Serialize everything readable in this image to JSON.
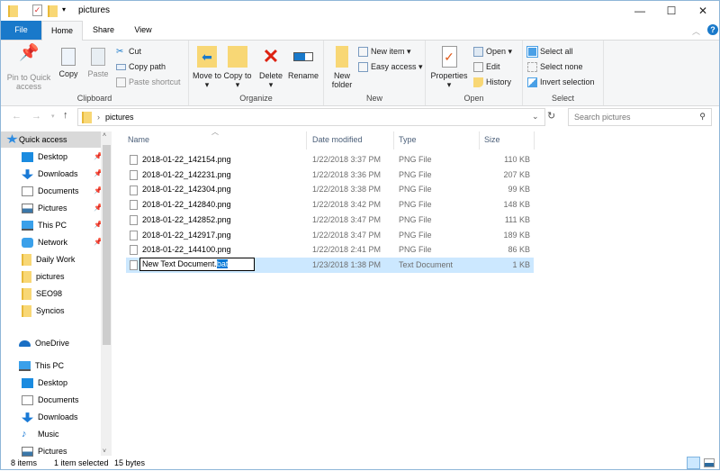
{
  "window": {
    "title": "pictures",
    "minimize": "—",
    "maximize": "☐",
    "close": "✕"
  },
  "tabs": [
    {
      "label": "File"
    },
    {
      "label": "Home"
    },
    {
      "label": "Share"
    },
    {
      "label": "View"
    }
  ],
  "ribbon": {
    "clipboard": {
      "label": "Clipboard",
      "pin": "Pin to Quick access",
      "copy": "Copy",
      "paste": "Paste",
      "cut": "Cut",
      "copy_path": "Copy path",
      "paste_shortcut": "Paste shortcut"
    },
    "organize": {
      "label": "Organize",
      "move_to": "Move to ▾",
      "copy_to": "Copy to ▾",
      "delete": "Delete",
      "rename": "Rename"
    },
    "new": {
      "label": "New",
      "new_folder": "New folder",
      "new_item": "New item ▾",
      "easy_access": "Easy access ▾"
    },
    "open": {
      "label": "Open",
      "properties": "Properties",
      "open": "Open ▾",
      "edit": "Edit",
      "history": "History"
    },
    "select": {
      "label": "Select",
      "select_all": "Select all",
      "select_none": "Select none",
      "invert": "Invert selection"
    }
  },
  "address": {
    "path": "pictures",
    "search_placeholder": "Search pictures"
  },
  "nav": [
    {
      "label": "Quick access",
      "icon": "star-icon",
      "level": 0,
      "selected": true
    },
    {
      "label": "Desktop",
      "icon": "desktop-icon",
      "level": 1,
      "pinned": true
    },
    {
      "label": "Downloads",
      "icon": "download-icon",
      "level": 1,
      "pinned": true
    },
    {
      "label": "Documents",
      "icon": "documents-icon",
      "level": 1,
      "pinned": true
    },
    {
      "label": "Pictures",
      "icon": "pictures-icon",
      "level": 1,
      "pinned": true
    },
    {
      "label": "This PC",
      "icon": "computer-icon",
      "level": 1,
      "pinned": true
    },
    {
      "label": "Network",
      "icon": "network-icon",
      "level": 1,
      "pinned": true
    },
    {
      "label": "Daily Work",
      "icon": "folder-icon",
      "level": 1
    },
    {
      "label": "pictures",
      "icon": "folder-icon",
      "level": 1
    },
    {
      "label": "SEO98",
      "icon": "folder-icon",
      "level": 1
    },
    {
      "label": "Syncios",
      "icon": "folder-icon",
      "level": 1
    },
    {
      "label": "OneDrive",
      "icon": "cloud-icon",
      "level": 0
    },
    {
      "label": "This PC",
      "icon": "computer-icon",
      "level": 0
    },
    {
      "label": "Desktop",
      "icon": "desktop-icon",
      "level": 1
    },
    {
      "label": "Documents",
      "icon": "documents-icon",
      "level": 1
    },
    {
      "label": "Downloads",
      "icon": "download-icon",
      "level": 1
    },
    {
      "label": "Music",
      "icon": "music-icon",
      "level": 1
    },
    {
      "label": "Pictures",
      "icon": "pictures-icon",
      "level": 1
    }
  ],
  "columns": {
    "name": "Name",
    "date": "Date modified",
    "type": "Type",
    "size": "Size"
  },
  "files": [
    {
      "name": "2018-01-22_142154.png",
      "date": "1/22/2018 3:37 PM",
      "type": "PNG File",
      "size": "110 KB"
    },
    {
      "name": "2018-01-22_142231.png",
      "date": "1/22/2018 3:36 PM",
      "type": "PNG File",
      "size": "207 KB"
    },
    {
      "name": "2018-01-22_142304.png",
      "date": "1/22/2018 3:38 PM",
      "type": "PNG File",
      "size": "99 KB"
    },
    {
      "name": "2018-01-22_142840.png",
      "date": "1/22/2018 3:42 PM",
      "type": "PNG File",
      "size": "148 KB"
    },
    {
      "name": "2018-01-22_142852.png",
      "date": "1/22/2018 3:47 PM",
      "type": "PNG File",
      "size": "111 KB"
    },
    {
      "name": "2018-01-22_142917.png",
      "date": "1/22/2018 3:47 PM",
      "type": "PNG File",
      "size": "189 KB"
    },
    {
      "name": "2018-01-22_144100.png",
      "date": "1/22/2018 2:41 PM",
      "type": "PNG File",
      "size": "86 KB"
    }
  ],
  "renaming": {
    "name_base": "New Text Document.",
    "name_ext": "bat",
    "date": "1/23/2018 1:38 PM",
    "type": "Text Document",
    "size": "1 KB"
  },
  "status": {
    "count": "8 items",
    "selected": "1 item selected",
    "size": "15 bytes"
  },
  "colors": {
    "accent": "#1979ca",
    "selection": "#cce8ff",
    "folder": "#f8d775"
  }
}
